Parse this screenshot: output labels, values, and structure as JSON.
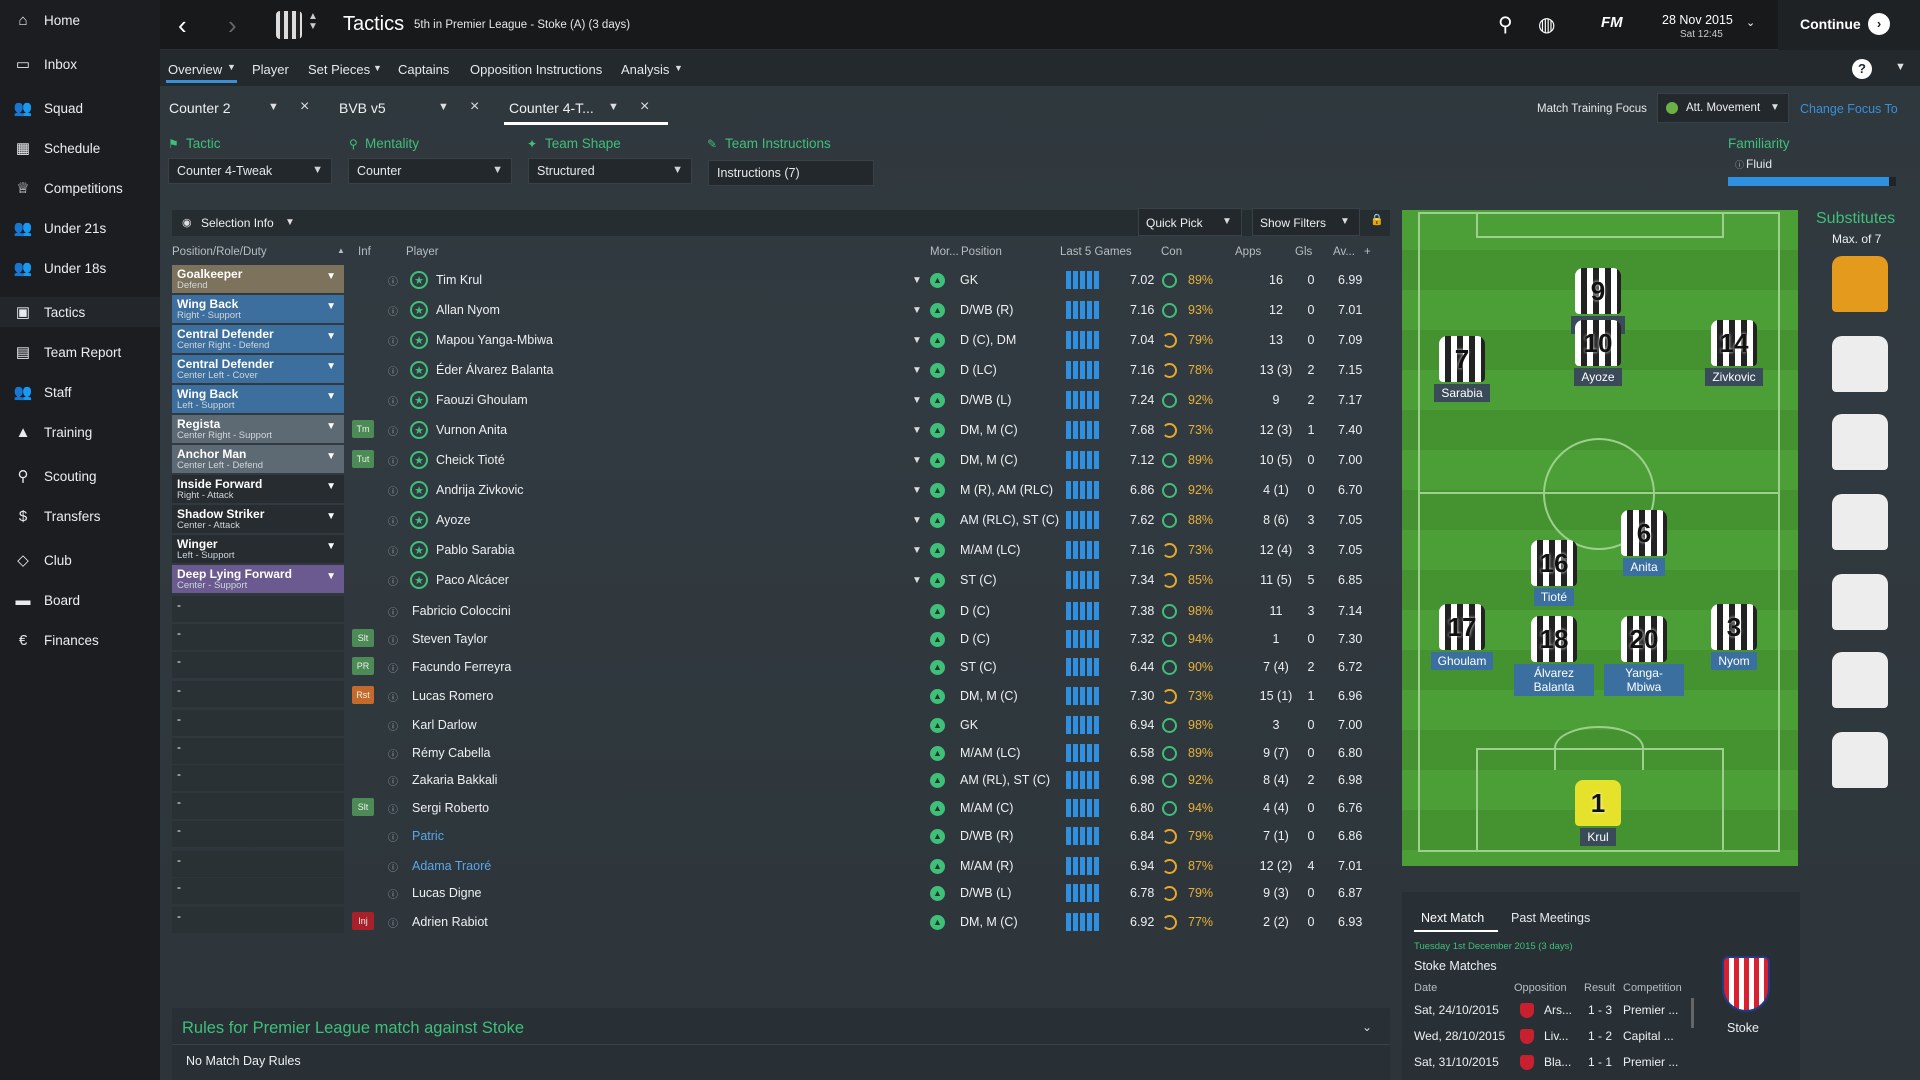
{
  "sidebar": {
    "items": [
      {
        "label": "Home",
        "icon": "home-icon"
      },
      {
        "label": "Inbox",
        "icon": "inbox-icon"
      },
      {
        "label": "Squad",
        "icon": "squad-icon"
      },
      {
        "label": "Schedule",
        "icon": "calendar-icon"
      },
      {
        "label": "Competitions",
        "icon": "trophy-icon"
      },
      {
        "label": "Under 21s",
        "icon": "u21-icon"
      },
      {
        "label": "Under 18s",
        "icon": "u18-icon"
      },
      {
        "label": "Tactics",
        "icon": "tactics-icon"
      },
      {
        "label": "Team Report",
        "icon": "report-icon"
      },
      {
        "label": "Staff",
        "icon": "staff-icon"
      },
      {
        "label": "Training",
        "icon": "training-icon"
      },
      {
        "label": "Scouting",
        "icon": "scouting-icon"
      },
      {
        "label": "Transfers",
        "icon": "transfers-icon"
      },
      {
        "label": "Club",
        "icon": "club-icon"
      },
      {
        "label": "Board",
        "icon": "board-icon"
      },
      {
        "label": "Finances",
        "icon": "finances-icon"
      }
    ]
  },
  "topbar": {
    "title": "Tactics",
    "subtitle": "5th in Premier League - Stoke (A) (3 days)",
    "date": "28 Nov 2015",
    "day_time": "Sat 12:45",
    "continue_label": "Continue",
    "fm_label": "FM"
  },
  "subnav": {
    "items": [
      "Overview",
      "Player",
      "Set Pieces",
      "Captains",
      "Opposition Instructions",
      "Analysis"
    ],
    "help": "?"
  },
  "tactic_tabs": [
    "Counter 2",
    "BVB v5",
    "Counter 4-T..."
  ],
  "training": {
    "label": "Match Training Focus",
    "value": "Att. Movement",
    "change_link": "Change Focus To"
  },
  "settings": {
    "tactic_label": "Tactic",
    "tactic_value": "Counter 4-Tweak",
    "mentality_label": "Mentality",
    "mentality_value": "Counter",
    "shape_label": "Team Shape",
    "shape_value": "Structured",
    "instructions_label": "Team Instructions",
    "instructions_value": "Instructions (7)",
    "familiarity_label": "Familiarity",
    "familiarity_value": "Fluid",
    "familiarity_level": 0.96
  },
  "toolbar": {
    "selection_info": "Selection Info",
    "quick_pick": "Quick Pick",
    "show_filters": "Show Filters"
  },
  "table": {
    "headers": [
      "Position/Role/Duty",
      "Inf",
      "Player",
      "Mor...",
      "Position",
      "Last 5 Games",
      "Con",
      "Apps",
      "Gls",
      "Av..."
    ],
    "roles": [
      {
        "title": "Goalkeeper",
        "duty": "Defend",
        "color": "#7d735c"
      },
      {
        "title": "Wing Back",
        "duty": "Right - Support",
        "color": "#3d6f9e"
      },
      {
        "title": "Central Defender",
        "duty": "Center Right - Defend",
        "color": "#3d6f9e"
      },
      {
        "title": "Central Defender",
        "duty": "Center Left - Cover",
        "color": "#3d6f9e"
      },
      {
        "title": "Wing Back",
        "duty": "Left - Support",
        "color": "#3d6f9e"
      },
      {
        "title": "Regista",
        "duty": "Center Right - Support",
        "color": "#5e6a73"
      },
      {
        "title": "Anchor Man",
        "duty": "Center Left - Defend",
        "color": "#5e6a73"
      },
      {
        "title": "Inside Forward",
        "duty": "Right - Attack",
        "color": "#262c30"
      },
      {
        "title": "Shadow Striker",
        "duty": "Center - Attack",
        "color": "#262c30"
      },
      {
        "title": "Winger",
        "duty": "Left - Support",
        "color": "#262c30"
      },
      {
        "title": "Deep Lying Forward",
        "duty": "Center - Support",
        "color": "#6a5a8f"
      }
    ],
    "starters": [
      {
        "name": "Tim Krul",
        "pos": "GK",
        "rating": "7.02",
        "con": "89%",
        "apps": "16",
        "gls": "0",
        "av": "6.99",
        "con_low": false
      },
      {
        "name": "Allan Nyom",
        "pos": "D/WB (R)",
        "rating": "7.16",
        "con": "93%",
        "apps": "12",
        "gls": "0",
        "av": "7.01",
        "con_low": false
      },
      {
        "name": "Mapou Yanga-Mbiwa",
        "pos": "D (C), DM",
        "rating": "7.04",
        "con": "79%",
        "apps": "13",
        "gls": "0",
        "av": "7.09",
        "con_low": true
      },
      {
        "name": "Éder Álvarez Balanta",
        "pos": "D (LC)",
        "rating": "7.16",
        "con": "78%",
        "apps": "13 (3)",
        "gls": "2",
        "av": "7.15",
        "con_low": true
      },
      {
        "name": "Faouzi Ghoulam",
        "pos": "D/WB (L)",
        "rating": "7.24",
        "con": "92%",
        "apps": "9",
        "gls": "2",
        "av": "7.17",
        "con_low": false
      },
      {
        "name": "Vurnon Anita",
        "pos": "DM, M (C)",
        "rating": "7.68",
        "con": "73%",
        "apps": "12 (3)",
        "gls": "1",
        "av": "7.40",
        "con_low": true
      },
      {
        "name": "Cheick Tioté",
        "pos": "DM, M (C)",
        "rating": "7.12",
        "con": "89%",
        "apps": "10 (5)",
        "gls": "0",
        "av": "7.00",
        "con_low": false
      },
      {
        "name": "Andrija Zivkovic",
        "pos": "M (R), AM (RLC)",
        "rating": "6.86",
        "con": "92%",
        "apps": "4 (1)",
        "gls": "0",
        "av": "6.70",
        "con_low": false
      },
      {
        "name": "Ayoze",
        "pos": "AM (RLC), ST (C)",
        "rating": "7.62",
        "con": "88%",
        "apps": "8 (6)",
        "gls": "3",
        "av": "7.05",
        "con_low": false
      },
      {
        "name": "Pablo Sarabia",
        "pos": "M/AM (LC)",
        "rating": "7.16",
        "con": "73%",
        "apps": "12 (4)",
        "gls": "3",
        "av": "7.05",
        "con_low": true
      },
      {
        "name": "Paco Alcácer",
        "pos": "ST (C)",
        "rating": "7.34",
        "con": "85%",
        "apps": "11 (5)",
        "gls": "5",
        "av": "6.85",
        "con_low": true
      }
    ],
    "reserves": [
      {
        "name": "Fabricio Coloccini",
        "pos": "D (C)",
        "rating": "7.38",
        "con": "98%",
        "apps": "11",
        "gls": "3",
        "av": "7.14",
        "con_low": false,
        "tag": ""
      },
      {
        "name": "Steven Taylor",
        "pos": "D (C)",
        "rating": "7.32",
        "con": "94%",
        "apps": "1",
        "gls": "0",
        "av": "7.30",
        "con_low": false,
        "tag": "Slt"
      },
      {
        "name": "Facundo Ferreyra",
        "pos": "ST (C)",
        "rating": "6.44",
        "con": "90%",
        "apps": "7 (4)",
        "gls": "2",
        "av": "6.72",
        "con_low": false,
        "tag": "PR"
      },
      {
        "name": "Lucas Romero",
        "pos": "DM, M (C)",
        "rating": "7.30",
        "con": "73%",
        "apps": "15 (1)",
        "gls": "1",
        "av": "6.96",
        "con_low": true,
        "tag": "Rst"
      },
      {
        "name": "Karl Darlow",
        "pos": "GK",
        "rating": "6.94",
        "con": "98%",
        "apps": "3",
        "gls": "0",
        "av": "7.00",
        "con_low": false,
        "tag": ""
      },
      {
        "name": "Rémy Cabella",
        "pos": "M/AM (LC)",
        "rating": "6.58",
        "con": "89%",
        "apps": "9 (7)",
        "gls": "0",
        "av": "6.80",
        "con_low": false,
        "tag": ""
      },
      {
        "name": "Zakaria Bakkali",
        "pos": "AM (RL), ST (C)",
        "rating": "6.98",
        "con": "92%",
        "apps": "8 (4)",
        "gls": "2",
        "av": "6.98",
        "con_low": false,
        "tag": ""
      },
      {
        "name": "Sergi Roberto",
        "pos": "M/AM (C)",
        "rating": "6.80",
        "con": "94%",
        "apps": "4 (4)",
        "gls": "0",
        "av": "6.76",
        "con_low": false,
        "tag": "Slt"
      },
      {
        "name": "Patric",
        "pos": "D/WB (R)",
        "rating": "6.84",
        "con": "79%",
        "apps": "7 (1)",
        "gls": "0",
        "av": "6.86",
        "con_low": true,
        "tag": ""
      },
      {
        "name": "Adama Traoré",
        "pos": "M/AM (R)",
        "rating": "6.94",
        "con": "87%",
        "apps": "12 (2)",
        "gls": "4",
        "av": "7.01",
        "con_low": true,
        "tag": ""
      },
      {
        "name": "Lucas Digne",
        "pos": "D/WB (L)",
        "rating": "6.78",
        "con": "79%",
        "apps": "9 (3)",
        "gls": "0",
        "av": "6.87",
        "con_low": true,
        "tag": ""
      },
      {
        "name": "Adrien Rabiot",
        "pos": "DM, M (C)",
        "rating": "6.92",
        "con": "77%",
        "apps": "2 (2)",
        "gls": "0",
        "av": "6.93",
        "con_low": true,
        "tag": "Inj"
      }
    ],
    "dash": "-"
  },
  "pitch": {
    "players": [
      {
        "num": "9",
        "name": "Alcácer"
      },
      {
        "num": "10",
        "name": "Ayoze"
      },
      {
        "num": "7",
        "name": "Sarabia"
      },
      {
        "num": "14",
        "name": "Zivkovic"
      },
      {
        "num": "6",
        "name": "Anita"
      },
      {
        "num": "16",
        "name": "Tioté"
      },
      {
        "num": "17",
        "name": "Ghoulam"
      },
      {
        "num": "18",
        "name": "Álvarez Balanta"
      },
      {
        "num": "20",
        "name": "Yanga-Mbiwa"
      },
      {
        "num": "3",
        "name": "Nyom"
      },
      {
        "num": "1",
        "name": "Krul"
      }
    ]
  },
  "substitutes": {
    "title": "Substitutes",
    "max": "Max. of 7"
  },
  "rules": {
    "title": "Rules for Premier League match against Stoke",
    "body": "No Match Day Rules"
  },
  "next_match": {
    "tab1": "Next Match",
    "tab2": "Past Meetings",
    "date_line": "Tuesday 1st December 2015 (3 days)",
    "section": "Stoke Matches",
    "headers": [
      "Date",
      "Opposition",
      "Result",
      "Competition"
    ],
    "rows": [
      {
        "date": "Sat, 24/10/2015",
        "opp": "Ars...",
        "result": "1 - 3",
        "comp": "Premier ..."
      },
      {
        "date": "Wed, 28/10/2015",
        "opp": "Liv...",
        "result": "1 - 2",
        "comp": "Capital ..."
      },
      {
        "date": "Sat, 31/10/2015",
        "opp": "Bla...",
        "result": "1 - 1",
        "comp": "Premier ..."
      }
    ],
    "club": "Stoke"
  }
}
